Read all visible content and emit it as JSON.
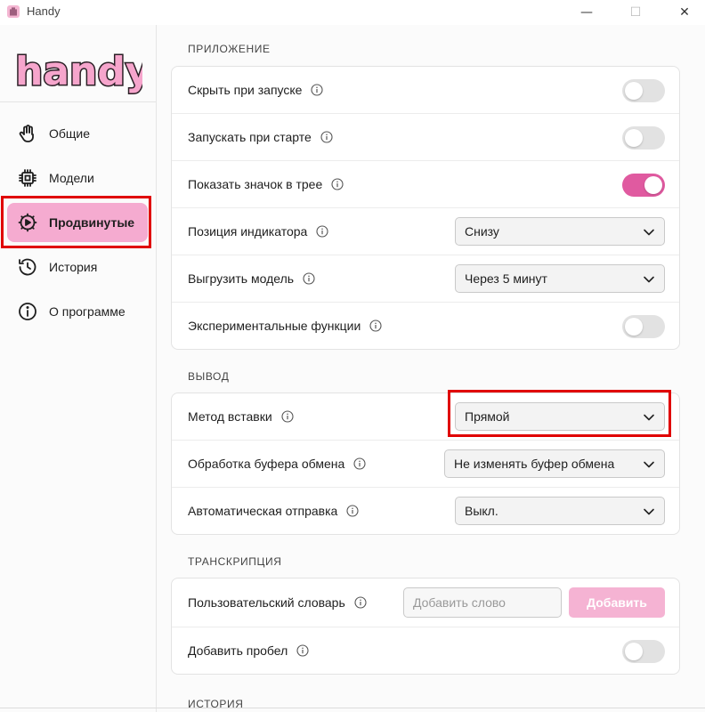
{
  "window": {
    "title": "Handy",
    "app_icon": "handy-app-icon",
    "controls": {
      "minimize": "—",
      "maximize": "☐",
      "close": "✕"
    }
  },
  "logo": {
    "text": "handy",
    "fill_color": "#f6a5cc",
    "stroke_color": "#2a1f25"
  },
  "sidebar": {
    "items": [
      {
        "label": "Общие",
        "icon": "hand-icon",
        "active": false
      },
      {
        "label": "Модели",
        "icon": "cpu-chip-icon",
        "active": false
      },
      {
        "label": "Продвинутые",
        "icon": "gear-play-icon",
        "active": true
      },
      {
        "label": "История",
        "icon": "history-icon",
        "active": false
      },
      {
        "label": "О программе",
        "icon": "info-icon",
        "active": false
      }
    ]
  },
  "sections": {
    "app": {
      "title": "ПРИЛОЖЕНИЕ",
      "rows": {
        "hide_on_launch": {
          "label": "Скрыть при запуске",
          "toggle": false
        },
        "autostart": {
          "label": "Запускать при старте",
          "toggle": false
        },
        "tray_icon": {
          "label": "Показать значок в трее",
          "toggle": true
        },
        "indicator_position": {
          "label": "Позиция индикатора",
          "value": "Снизу"
        },
        "unload_model": {
          "label": "Выгрузить модель",
          "value": "Через 5 минут"
        },
        "experimental": {
          "label": "Экспериментальные функции",
          "toggle": false
        }
      }
    },
    "output": {
      "title": "ВЫВОД",
      "rows": {
        "paste_method": {
          "label": "Метод вставки",
          "value": "Прямой"
        },
        "clipboard": {
          "label": "Обработка буфера обмена",
          "value": "Не изменять буфер обмена"
        },
        "auto_send": {
          "label": "Автоматическая отправка",
          "value": "Выкл."
        }
      }
    },
    "transcription": {
      "title": "ТРАНСКРИПЦИЯ",
      "rows": {
        "dictionary": {
          "label": "Пользовательский словарь",
          "placeholder": "Добавить слово",
          "button": "Добавить"
        },
        "add_space": {
          "label": "Добавить пробел",
          "toggle": false
        }
      }
    },
    "history": {
      "title": "ИСТОРИЯ"
    }
  },
  "colors": {
    "accent": "#e05aa0",
    "active_nav": "#f5abd0",
    "disabled_button": "#f5b3d3",
    "annotation_red": "#e00000"
  }
}
